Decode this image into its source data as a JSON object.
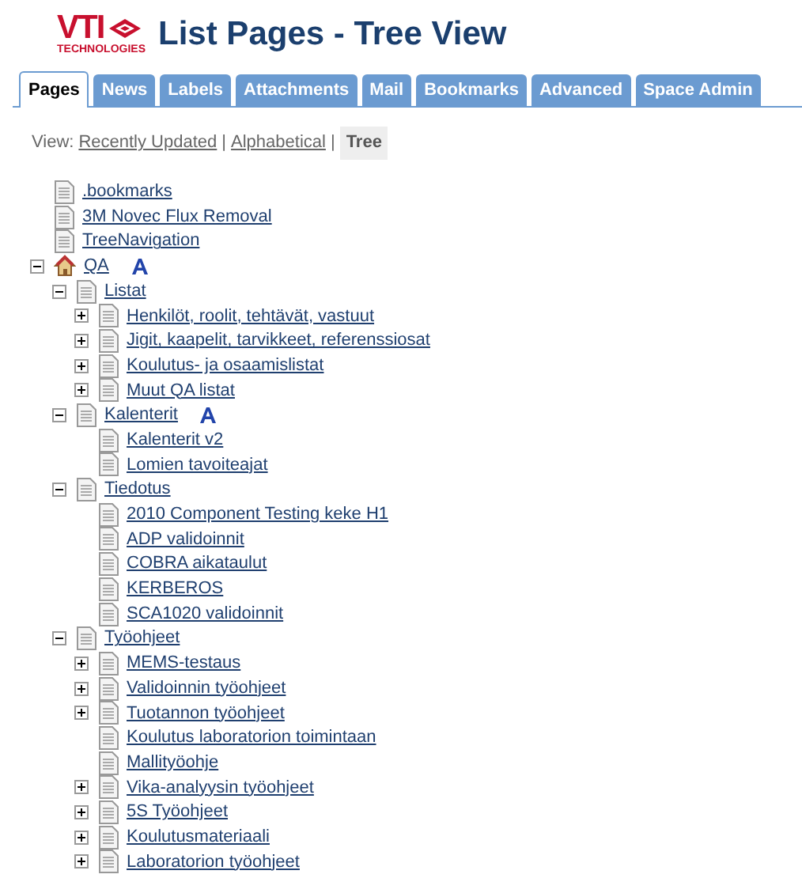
{
  "logo": {
    "name": "VTI",
    "tagline": "TECHNOLOGIES"
  },
  "title": "List Pages - Tree View",
  "tabs": [
    {
      "label": "Pages",
      "selected": true
    },
    {
      "label": "News",
      "selected": false
    },
    {
      "label": "Labels",
      "selected": false
    },
    {
      "label": "Attachments",
      "selected": false
    },
    {
      "label": "Mail",
      "selected": false
    },
    {
      "label": "Bookmarks",
      "selected": false
    },
    {
      "label": "Advanced",
      "selected": false
    },
    {
      "label": "Space Admin",
      "selected": false
    }
  ],
  "view": {
    "label": "View:",
    "options": [
      {
        "label": "Recently Updated",
        "selected": false
      },
      {
        "separator": "|",
        "label": "Alphabetical",
        "selected": false
      },
      {
        "separator": "|",
        "label": "Tree",
        "selected": true
      }
    ]
  },
  "tree": [
    {
      "label": ".bookmarks",
      "kind": "page"
    },
    {
      "label": "3M Novec Flux Removal",
      "kind": "page"
    },
    {
      "label": "TreeNavigation",
      "kind": "page"
    },
    {
      "label": "QA",
      "kind": "home",
      "expanded": true,
      "a_icon": true,
      "children": [
        {
          "label": "Listat",
          "kind": "page",
          "expanded": true,
          "children": [
            {
              "label": "Henkilöt, roolit, tehtävät, vastuut",
              "kind": "page",
              "expanded": false
            },
            {
              "label": "Jigit, kaapelit, tarvikkeet, referenssiosat",
              "kind": "page",
              "expanded": false
            },
            {
              "label": "Koulutus- ja osaamislistat",
              "kind": "page",
              "expanded": false
            },
            {
              "label": "Muut QA listat",
              "kind": "page",
              "expanded": false
            }
          ]
        },
        {
          "label": "Kalenterit",
          "kind": "page",
          "expanded": true,
          "a_icon": true,
          "children": [
            {
              "label": "Kalenterit v2",
              "kind": "page"
            },
            {
              "label": "Lomien tavoiteajat",
              "kind": "page"
            }
          ]
        },
        {
          "label": "Tiedotus",
          "kind": "page",
          "expanded": true,
          "children": [
            {
              "label": "2010 Component Testing keke H1",
              "kind": "page"
            },
            {
              "label": "ADP validoinnit",
              "kind": "page"
            },
            {
              "label": "COBRA aikataulut",
              "kind": "page"
            },
            {
              "label": "KERBEROS",
              "kind": "page"
            },
            {
              "label": "SCA1020 validoinnit",
              "kind": "page"
            }
          ]
        },
        {
          "label": "Työohjeet",
          "kind": "page",
          "expanded": true,
          "children": [
            {
              "label": "MEMS-testaus",
              "kind": "page",
              "expanded": false
            },
            {
              "label": "Validoinnin työohjeet",
              "kind": "page",
              "expanded": false
            },
            {
              "label": "Tuotannon työohjeet",
              "kind": "page",
              "expanded": false
            },
            {
              "label": "Koulutus laboratorion toimintaan",
              "kind": "page"
            },
            {
              "label": "Mallityöohje",
              "kind": "page"
            },
            {
              "label": "Vika-analyysin työohjeet",
              "kind": "page",
              "expanded": false
            },
            {
              "label": "5S Työohjeet",
              "kind": "page",
              "expanded": false
            },
            {
              "label": "Koulutusmateriaali",
              "kind": "page",
              "expanded": false
            },
            {
              "label": "Laboratorion työohjeet",
              "kind": "page",
              "expanded": false
            }
          ]
        }
      ]
    }
  ]
}
